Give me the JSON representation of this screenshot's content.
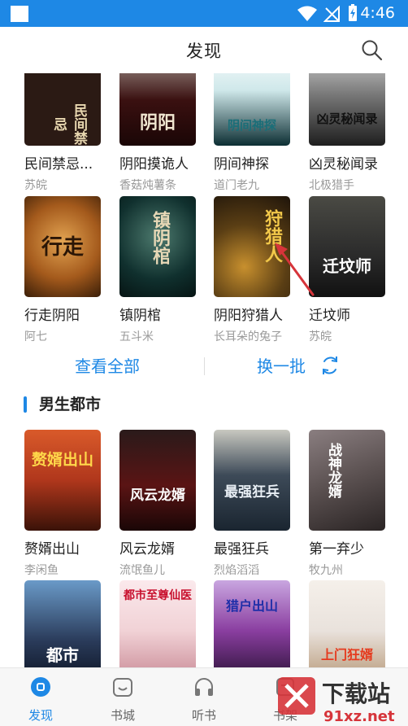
{
  "status": {
    "time": "4:46"
  },
  "header": {
    "title": "发现"
  },
  "grid1": [
    {
      "title": "民间禁忌...",
      "author": "苏皖",
      "cover_text": "民间禁忌",
      "bg": "#2b1a14"
    },
    {
      "title": "阴阳摸诡人",
      "author": "香菇炖薯条",
      "cover_text": "阴阳",
      "bg": "#3a1010"
    },
    {
      "title": "阴间神探",
      "author": "道门老九",
      "cover_text": "阴间神探",
      "bg": "#0c2e33"
    },
    {
      "title": "凶灵秘闻录",
      "author": "北极猎手",
      "cover_text": "凶灵秘闻录",
      "bg": "#1e1e1e"
    },
    {
      "title": "行走阴阳",
      "author": "阿七",
      "cover_text": "行走",
      "bg": "#7a3e12"
    },
    {
      "title": "镇阴棺",
      "author": "五斗米",
      "cover_text": "镇阴棺",
      "bg": "#10302e"
    },
    {
      "title": "阴阳狩猎人",
      "author": "长耳朵的兔子",
      "cover_text": "狩猎人",
      "bg": "#3b2a12"
    },
    {
      "title": "迁坟师",
      "author": "苏皖",
      "cover_text": "迁坟师",
      "bg": "#2a2a2a"
    }
  ],
  "actions": {
    "more_label": "查看全部",
    "refresh_label": "换一批"
  },
  "section": {
    "title": "男生都市"
  },
  "grid2": [
    {
      "title": "赘婿出山",
      "author": "李闲鱼",
      "cover_text": "赘婿出山",
      "bg": "#b0371c"
    },
    {
      "title": "风云龙婿",
      "author": "流氓鱼儿",
      "cover_text": "风云龙婿",
      "bg": "#5a1414"
    },
    {
      "title": "最强狂兵",
      "author": "烈焰滔滔",
      "cover_text": "最强狂兵",
      "bg": "#3d4a58"
    },
    {
      "title": "第一弃少",
      "author": "牧九州",
      "cover_text": "战神龙婿",
      "bg": "#5a5050"
    },
    {
      "title": "",
      "author": "",
      "cover_text": "都市",
      "bg": "#2a3b5a"
    },
    {
      "title": "",
      "author": "",
      "cover_text": "都市至尊仙医",
      "bg": "#f1d2d6"
    },
    {
      "title": "",
      "author": "",
      "cover_text": "猎户出山",
      "bg": "#8a3ea0"
    },
    {
      "title": "",
      "author": "",
      "cover_text": "上门狂婿",
      "bg": "#e9e2dc"
    }
  ],
  "nav": [
    {
      "label": "发现",
      "icon": "discover-icon"
    },
    {
      "label": "书城",
      "icon": "bookstore-icon"
    },
    {
      "label": "听书",
      "icon": "headphones-icon"
    },
    {
      "label": "书架",
      "icon": "bookshelf-icon"
    }
  ],
  "watermark": {
    "line1": "下载站",
    "line2": "91xz.net"
  },
  "colors": {
    "accent": "#1e88e5",
    "status_bar": "#1e88e5",
    "annotation": "#d6343a"
  }
}
